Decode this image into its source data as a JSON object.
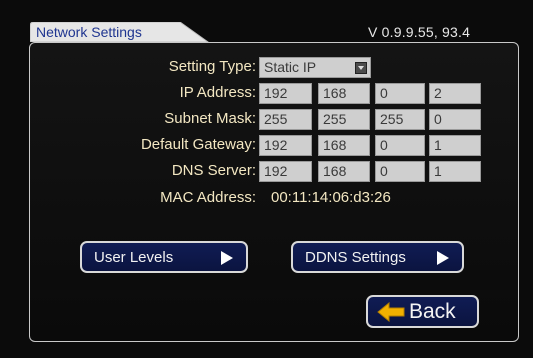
{
  "header": {
    "tab_title": "Network Settings",
    "version": "V  0.9.9.55, 93.4"
  },
  "form": {
    "setting_type": {
      "label": "Setting Type:",
      "value": "Static  IP"
    },
    "ip_address": {
      "label": "IP Address:",
      "octets": [
        "192",
        "168",
        "0",
        "2"
      ]
    },
    "subnet_mask": {
      "label": "Subnet Mask:",
      "octets": [
        "255",
        "255",
        "255",
        "0"
      ]
    },
    "default_gateway": {
      "label": "Default Gateway:",
      "octets": [
        "192",
        "168",
        "0",
        "1"
      ]
    },
    "dns_server": {
      "label": "DNS Server:",
      "octets": [
        "192",
        "168",
        "0",
        "1"
      ]
    },
    "mac_address": {
      "label": "MAC Address:",
      "value": "00:11:14:06:d3:26"
    }
  },
  "buttons": {
    "user_levels": "User Levels",
    "ddns_settings": "DDNS Settings",
    "back": "Back"
  },
  "icons": {
    "dropdown": "chevron-down-icon",
    "play": "play-icon",
    "back_arrow": "arrow-left-icon"
  },
  "colors": {
    "label_text": "#f3e7c2",
    "field_bg": "#cfcfcf",
    "button_bg": "#0e1a4f",
    "tab_bg": "#e6e6e6",
    "back_arrow": "#f2b100"
  }
}
